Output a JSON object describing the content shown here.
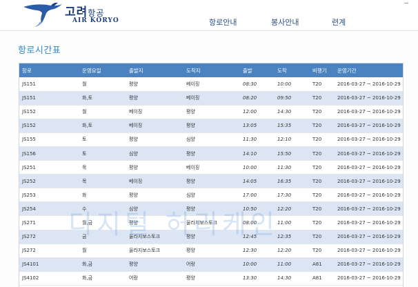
{
  "header": {
    "logo_korean": "고려",
    "logo_korean_small": "항공",
    "logo_english": "AIR KORYO",
    "nav": [
      "항로안내",
      "봉사안내",
      "련계"
    ]
  },
  "page": {
    "title": "항로시간표"
  },
  "table": {
    "columns": [
      "항로",
      "운영요일",
      "출발지",
      "도착지",
      "출발",
      "도착",
      "비행기",
      "운영기간"
    ],
    "rows": [
      [
        "JS151",
        "월",
        "평양",
        "베이징",
        "08:30",
        "10:00",
        "T20",
        "2016-03-27 ~ 2016-10-29"
      ],
      [
        "JS151",
        "화,토",
        "평양",
        "베이징",
        "08:20",
        "09:50",
        "T20",
        "2016-03-27 ~ 2016-10-29"
      ],
      [
        "JS152",
        "월",
        "베이징",
        "평양",
        "12:00",
        "14:30",
        "T20",
        "2016-03-27 ~ 2016-10-29"
      ],
      [
        "JS152",
        "화,토",
        "베이징",
        "평양",
        "13:05",
        "15:35",
        "T20",
        "2016-03-27 ~ 2016-10-29"
      ],
      [
        "JS155",
        "토",
        "평양",
        "심양",
        "11:30",
        "12:10",
        "T20",
        "2016-03-27 ~ 2016-10-29"
      ],
      [
        "JS156",
        "토",
        "심양",
        "평양",
        "14:10",
        "15:50",
        "T20",
        "2016-03-27 ~ 2016-10-29"
      ],
      [
        "JS251",
        "목",
        "평양",
        "베이징",
        "10:00",
        "11:30",
        "T20",
        "2016-03-27 ~ 2016-10-29"
      ],
      [
        "JS252",
        "목",
        "베이징",
        "평양",
        "14:05",
        "16:35",
        "T20",
        "2016-03-27 ~ 2016-10-29"
      ],
      [
        "JS253",
        "화",
        "평양",
        "심양",
        "17:00",
        "17:30",
        "T20",
        "2016-03-27 ~ 2016-10-29"
      ],
      [
        "JS254",
        "수",
        "심양",
        "평양",
        "10:50",
        "12:20",
        "T20",
        "2016-03-27 ~ 2016-10-29"
      ],
      [
        "JS271",
        "월,금",
        "평양",
        "울라지보스토크",
        "08:00",
        "11:00",
        "T20",
        "2016-03-27 ~ 2016-10-29"
      ],
      [
        "JS272",
        "금",
        "울라지보스토크",
        "평양",
        "12:45",
        "12:35",
        "T20",
        "2016-03-27 ~ 2016-10-29"
      ],
      [
        "JS272",
        "월",
        "울라지보스토크",
        "평양",
        "12:30",
        "12:20",
        "T20",
        "2016-03-27 ~ 2016-10-29"
      ],
      [
        "JS4101",
        "화,금",
        "평양",
        "어랑",
        "10:00",
        "11:00",
        "A81",
        "2016-03-27 ~ 2016-10-29"
      ],
      [
        "JS4102",
        "화,금",
        "어랑",
        "평양",
        "13:30",
        "14:30",
        "A81",
        "2016-03-27 ~ 2016-10-29"
      ]
    ]
  },
  "watermark": "디지털 허리케인",
  "colors": {
    "header_bg": "#4a83c0",
    "alt_row": "#dbe5f3",
    "title": "#2f87c8",
    "brand": "#1b3f7f"
  }
}
